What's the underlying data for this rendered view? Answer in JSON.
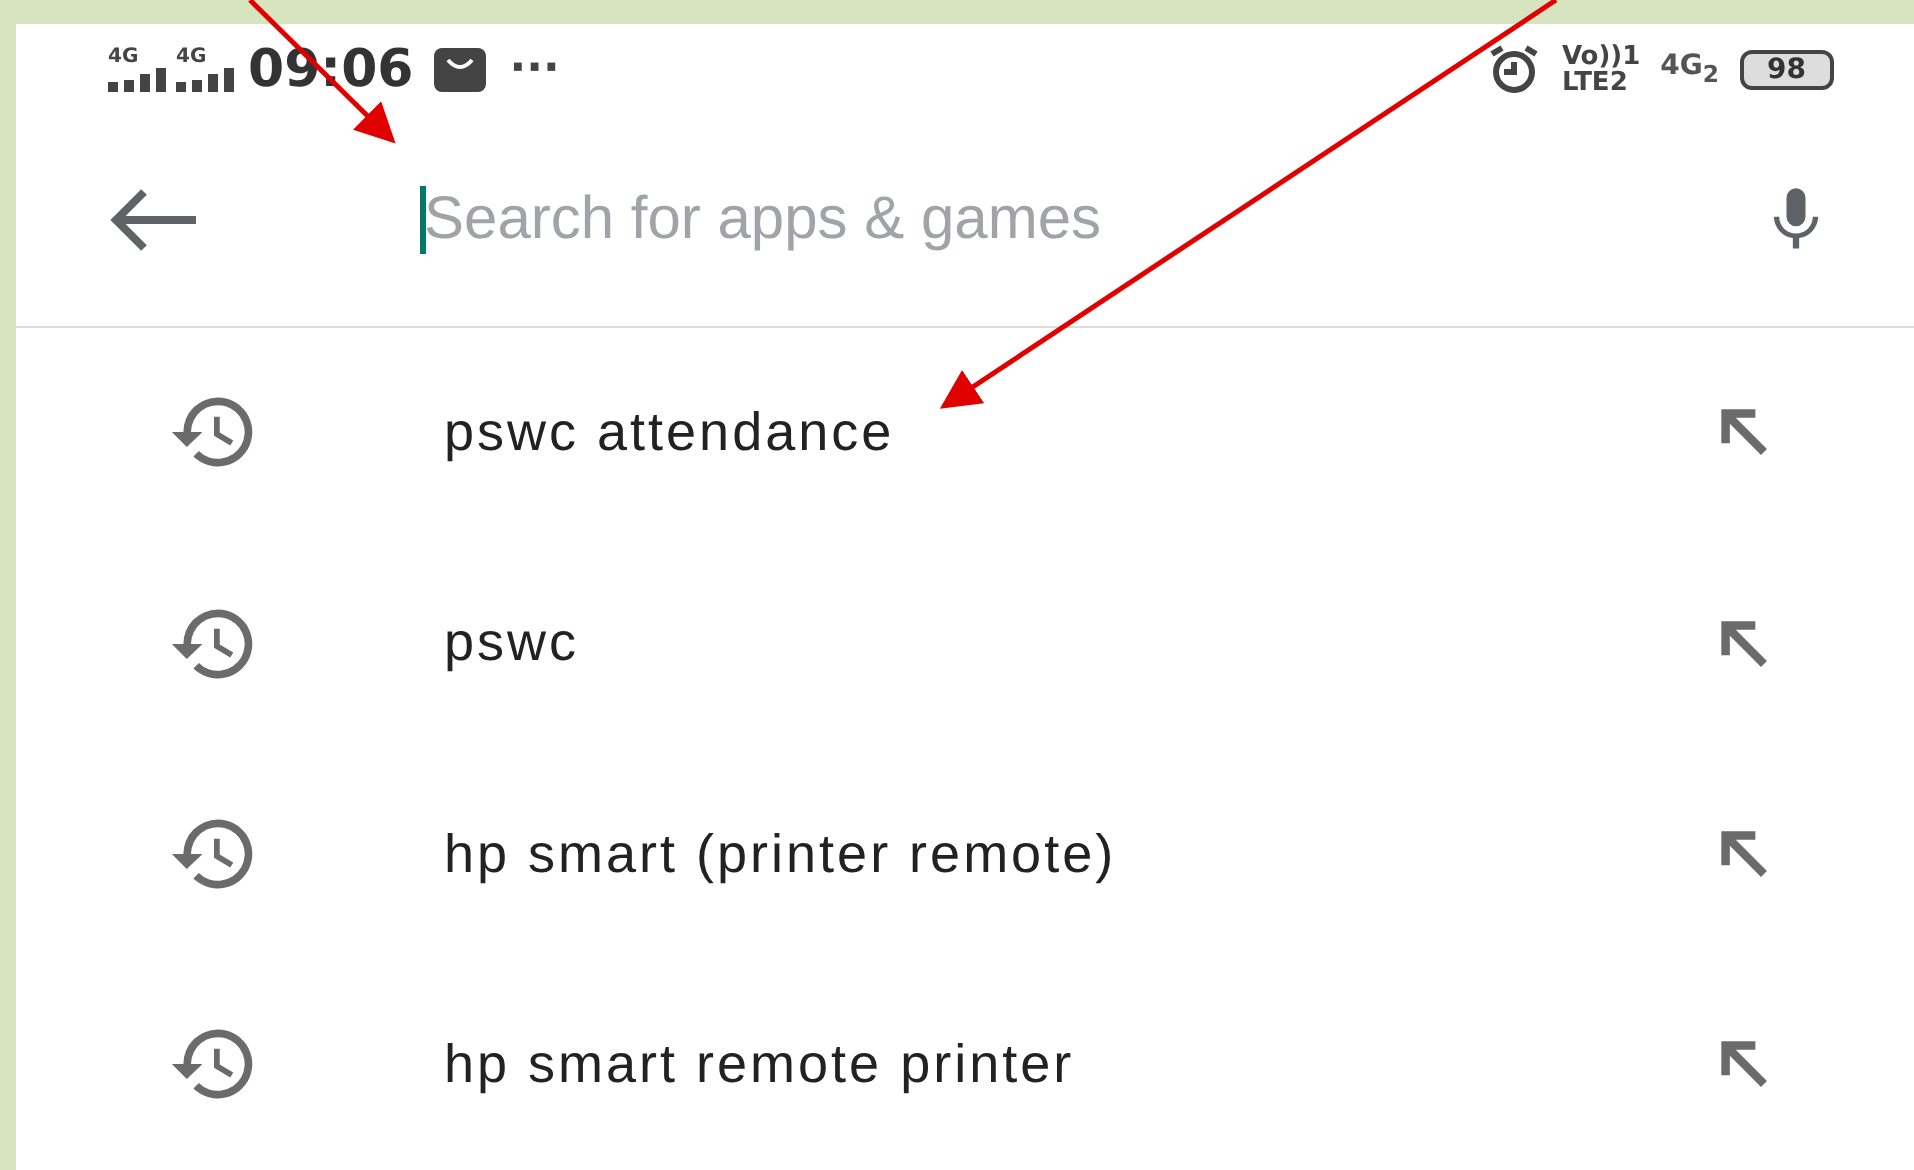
{
  "status_bar": {
    "sim_1": "4G",
    "sim_2": "4G",
    "time": "09:06",
    "more": "···",
    "volte_top": "Vo))1",
    "volte_bottom": "LTE2",
    "network": "4G$_{2}$",
    "battery": "98"
  },
  "search": {
    "placeholder": "Search for apps & games"
  },
  "suggestions": [
    {
      "text": "pswc attendance"
    },
    {
      "text": "pswc"
    },
    {
      "text": "hp smart (printer remote)"
    },
    {
      "text": "hp smart remote printer"
    }
  ]
}
